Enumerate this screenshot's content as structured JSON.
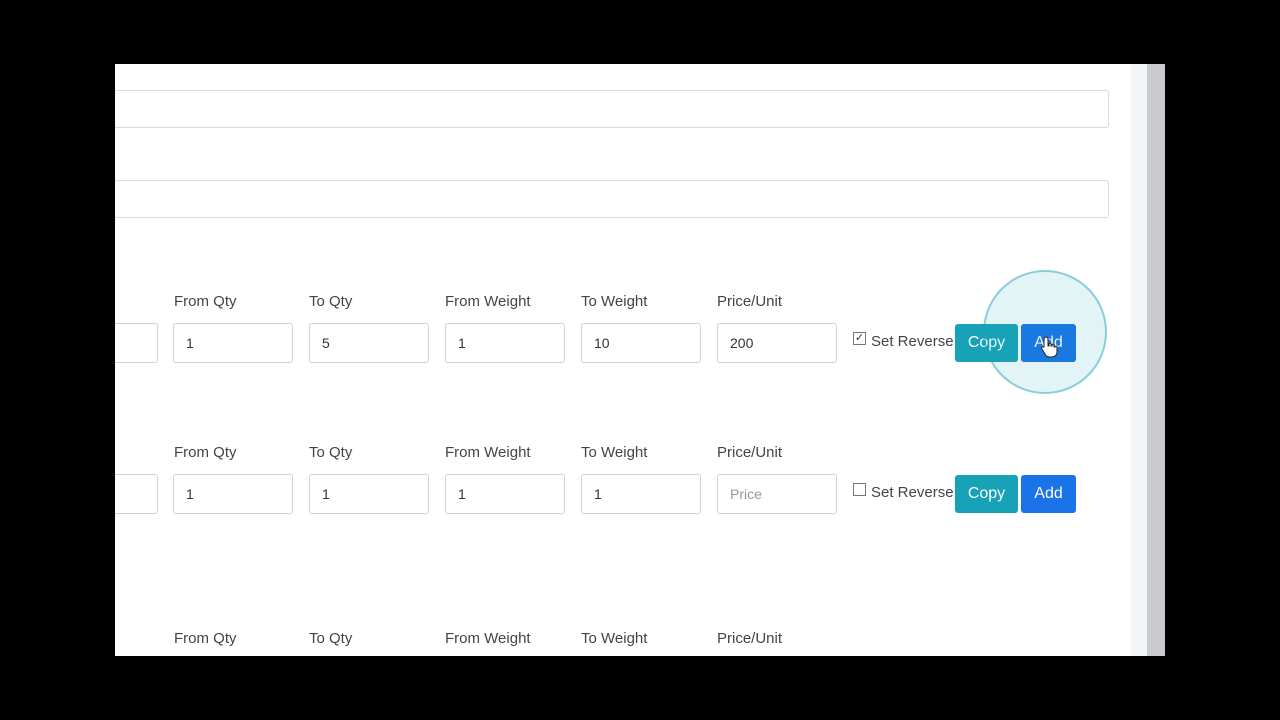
{
  "labels": {
    "from_qty": "From Qty",
    "to_qty": "To Qty",
    "from_weight": "From Weight",
    "to_weight": "To Weight",
    "price_unit": "Price/Unit",
    "set_reverse": "Set Reverse",
    "copy": "Copy",
    "add": "Add"
  },
  "rows": [
    {
      "from_qty": "1",
      "to_qty": "5",
      "from_weight": "1",
      "to_weight": "10",
      "price": "200",
      "price_placeholder": "Price",
      "set_reverse_checked": true,
      "set_reverse_mark": "✓"
    },
    {
      "from_qty": "1",
      "to_qty": "1",
      "from_weight": "1",
      "to_weight": "1",
      "price": "",
      "price_placeholder": "Price",
      "set_reverse_checked": false,
      "set_reverse_mark": ""
    }
  ],
  "colors": {
    "copy_button": "#17a2b8",
    "add_button": "#1a73e8"
  }
}
